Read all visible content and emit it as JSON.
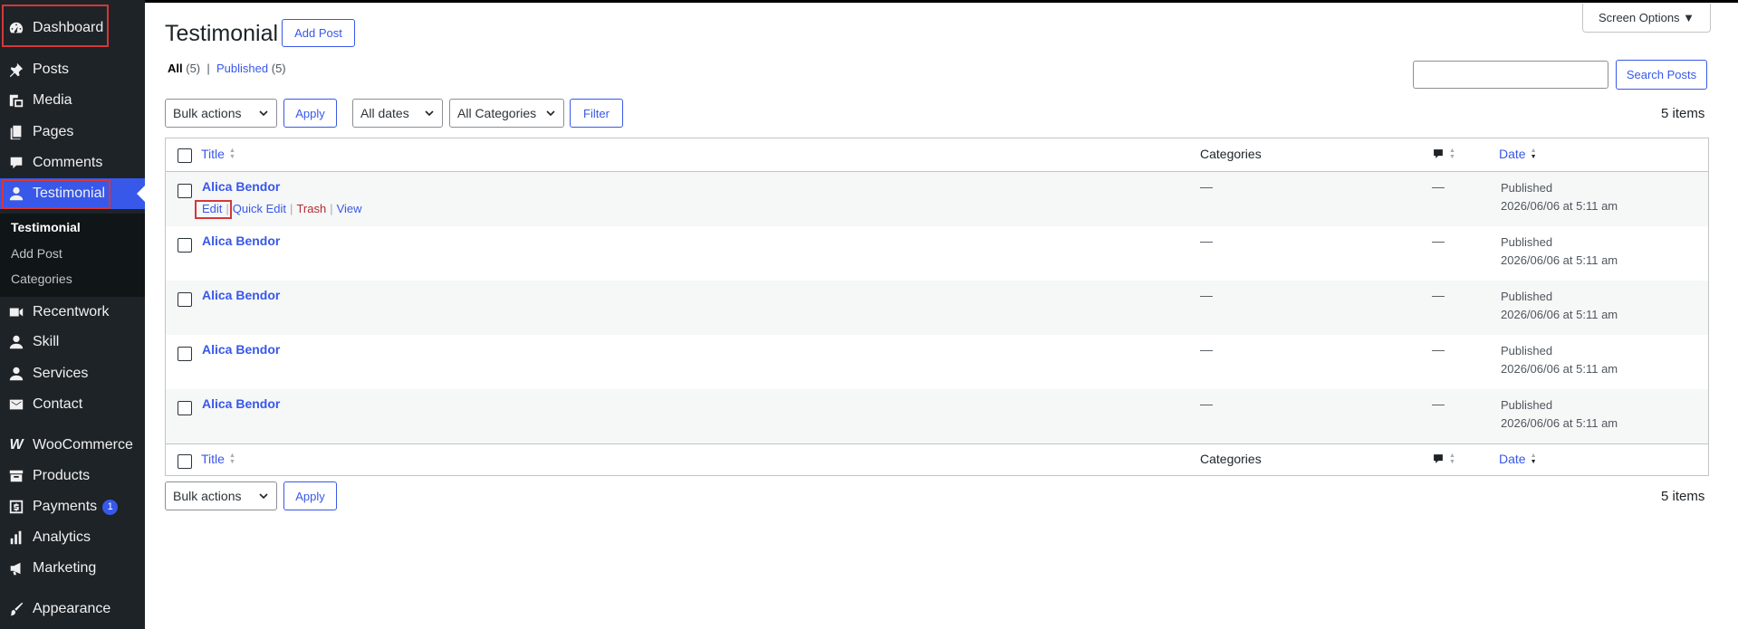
{
  "sidebar": {
    "items": [
      {
        "label": "Dashboard",
        "icon": "dashboard-icon"
      },
      {
        "label": "Posts",
        "icon": "pin-icon"
      },
      {
        "label": "Media",
        "icon": "media-icon"
      },
      {
        "label": "Pages",
        "icon": "pages-icon"
      },
      {
        "label": "Comments",
        "icon": "comment-icon"
      },
      {
        "label": "Testimonial",
        "icon": "user-icon"
      },
      {
        "label": "Recentwork",
        "icon": "video-icon"
      },
      {
        "label": "Skill",
        "icon": "user-icon"
      },
      {
        "label": "Services",
        "icon": "user-icon"
      },
      {
        "label": "Contact",
        "icon": "email-icon"
      },
      {
        "label": "WooCommerce",
        "icon": "woo-icon"
      },
      {
        "label": "Products",
        "icon": "archive-icon"
      },
      {
        "label": "Payments",
        "icon": "dollar-icon",
        "badge": "1"
      },
      {
        "label": "Analytics",
        "icon": "bar-chart-icon"
      },
      {
        "label": "Marketing",
        "icon": "megaphone-icon"
      },
      {
        "label": "Appearance",
        "icon": "brush-icon"
      }
    ],
    "submenu": [
      {
        "label": "Testimonial"
      },
      {
        "label": "Add Post"
      },
      {
        "label": "Categories"
      }
    ],
    "bg_color": "#1d2327",
    "active_color": "#3858e9"
  },
  "header": {
    "title": "Testimonial",
    "add_post": "Add Post",
    "screen_options": "Screen Options ▼"
  },
  "filters": {
    "all_label": "All",
    "all_count": "(5)",
    "separator": "|",
    "published_label": "Published",
    "published_count": "(5)",
    "bulk_actions": "Bulk actions",
    "apply": "Apply",
    "dates": "All dates",
    "categories": "All Categories",
    "filter": "Filter",
    "search_button": "Search Posts",
    "search_value": "",
    "items_count": "5 items"
  },
  "table": {
    "columns": {
      "title": "Title",
      "categories": "Categories",
      "date": "Date"
    },
    "rows": [
      {
        "title": "Alica Bendor",
        "categories": "—",
        "comments": "—",
        "status": "Published",
        "date": "2026/06/06 at 5:11 am"
      },
      {
        "title": "Alica Bendor",
        "categories": "—",
        "comments": "—",
        "status": "Published",
        "date": "2026/06/06 at 5:11 am"
      },
      {
        "title": "Alica Bendor",
        "categories": "—",
        "comments": "—",
        "status": "Published",
        "date": "2026/06/06 at 5:11 am"
      },
      {
        "title": "Alica Bendor",
        "categories": "—",
        "comments": "—",
        "status": "Published",
        "date": "2026/06/06 at 5:11 am"
      },
      {
        "title": "Alica Bendor",
        "categories": "—",
        "comments": "—",
        "status": "Published",
        "date": "2026/06/06 at 5:11 am"
      }
    ],
    "row_actions": {
      "edit": "Edit",
      "quick_edit": "Quick Edit",
      "trash": "Trash",
      "view": "View",
      "sep": "|"
    }
  },
  "bottom": {
    "bulk_actions": "Bulk actions",
    "apply": "Apply",
    "items_count": "5 items"
  }
}
